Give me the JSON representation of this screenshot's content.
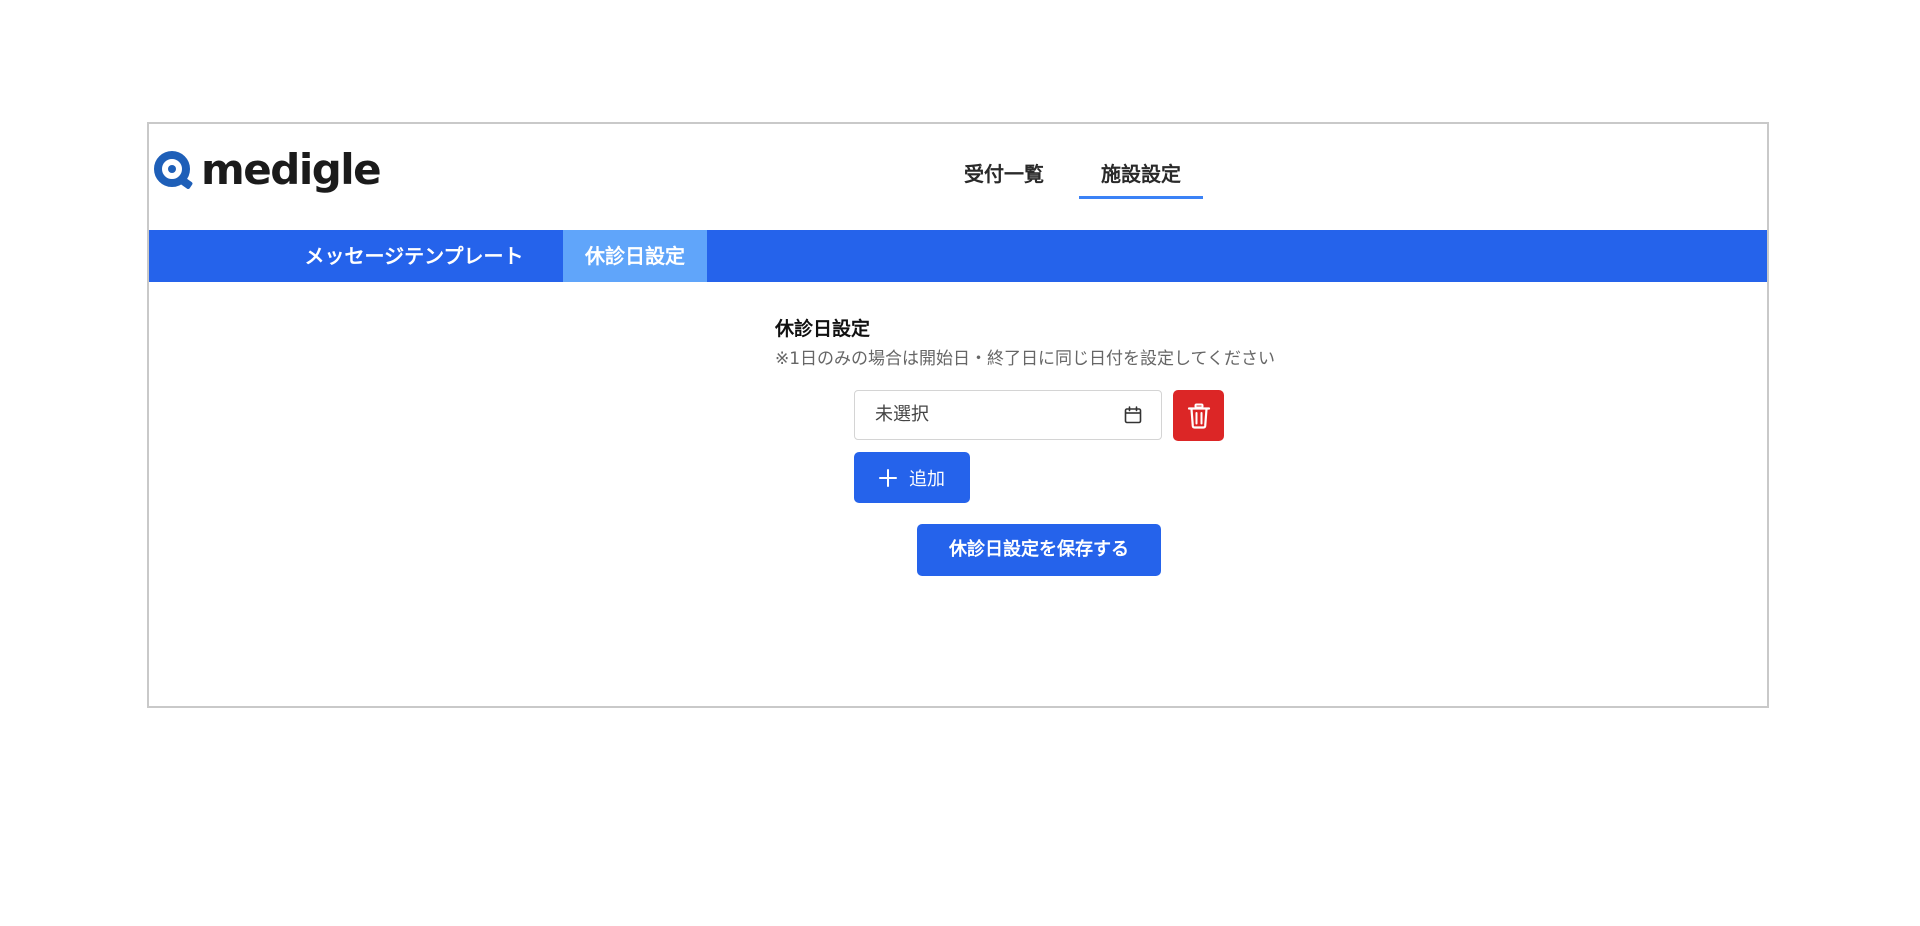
{
  "brand": {
    "logo_text": "medigle",
    "colors": {
      "primary": "#2563eb",
      "subnav_active": "#60a5fa",
      "danger": "#dc2626",
      "logo_mark": "#1e5fb8"
    }
  },
  "top_nav": {
    "items": [
      {
        "label": "受付一覧",
        "active": false
      },
      {
        "label": "施設設定",
        "active": true
      }
    ]
  },
  "sub_nav": {
    "items": [
      {
        "label": "メッセージテンプレート",
        "active": false
      },
      {
        "label": "休診日設定",
        "active": true
      }
    ]
  },
  "holiday_settings": {
    "title": "休診日設定",
    "note": "※1日のみの場合は開始日・終了日に同じ日付を設定してください",
    "date_rows": [
      {
        "value": "未選択",
        "icon": "calendar-icon",
        "delete_icon": "trash-icon"
      }
    ],
    "add_button": {
      "icon": "plus-icon",
      "label": "追加"
    },
    "save_button": {
      "label": "休診日設定を保存する"
    }
  }
}
